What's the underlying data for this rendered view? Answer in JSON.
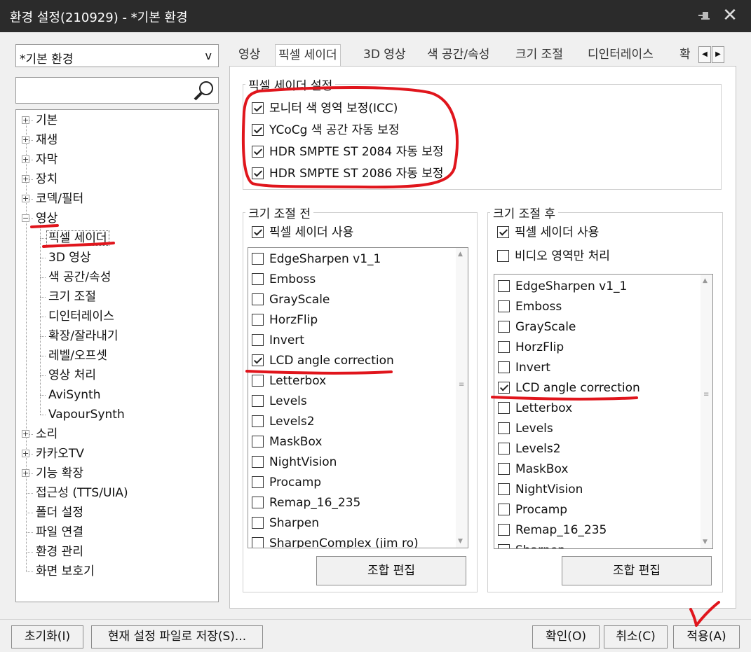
{
  "window": {
    "title": "환경 설정(210929) - *기본 환경",
    "pin_icon": "pin-icon",
    "close_icon": "close-icon"
  },
  "preset": {
    "value": "*기본 환경",
    "arrow": "v"
  },
  "search": {
    "value": "",
    "icon": "search-icon"
  },
  "tree": {
    "items": [
      {
        "label": "기본",
        "expander": "+"
      },
      {
        "label": "재생",
        "expander": "+"
      },
      {
        "label": "자막",
        "expander": "+"
      },
      {
        "label": "장치",
        "expander": "+"
      },
      {
        "label": "코덱/필터",
        "expander": "+"
      },
      {
        "label": "영상",
        "expander": "−"
      },
      {
        "label": "픽셀 세이더",
        "child": true,
        "selected": true
      },
      {
        "label": "3D 영상",
        "child": true
      },
      {
        "label": "색 공간/속성",
        "child": true
      },
      {
        "label": "크기 조절",
        "child": true
      },
      {
        "label": "디인터레이스",
        "child": true
      },
      {
        "label": "확장/잘라내기",
        "child": true
      },
      {
        "label": "레벨/오프셋",
        "child": true
      },
      {
        "label": "영상 처리",
        "child": true
      },
      {
        "label": "AviSynth",
        "child": true
      },
      {
        "label": "VapourSynth",
        "child": true
      },
      {
        "label": "소리",
        "expander": "+"
      },
      {
        "label": "카카오TV",
        "expander": "+"
      },
      {
        "label": "기능 확장",
        "expander": "+"
      },
      {
        "label": "접근성 (TTS/UIA)"
      },
      {
        "label": "폴더 설정"
      },
      {
        "label": "파일 연결"
      },
      {
        "label": "환경 관리"
      },
      {
        "label": "화면 보호기"
      }
    ]
  },
  "tabs": [
    "영상",
    "픽셀 세이더",
    "3D 영상",
    "색 공간/속성",
    "크기 조절",
    "디인터레이스",
    "확"
  ],
  "tab_nav": {
    "prev": "◀",
    "next": "▶"
  },
  "shader_settings": {
    "legend": "픽셀 세이더 설정",
    "options": [
      {
        "label": "모니터 색 영역 보정(ICC)",
        "checked": true
      },
      {
        "label": "YCoCg 색 공간 자동 보정",
        "checked": true
      },
      {
        "label": "HDR SMPTE ST 2084 자동 보정",
        "checked": true
      },
      {
        "label": "HDR SMPTE ST 2086 자동 보정",
        "checked": true
      }
    ]
  },
  "pre_resize": {
    "legend": "크기 조절 전",
    "use_shader": {
      "label": "픽셀 세이더 사용",
      "checked": true
    },
    "list": [
      "EdgeSharpen v1_1",
      "Emboss",
      "GrayScale",
      "HorzFlip",
      "Invert",
      "LCD angle correction",
      "Letterbox",
      "Levels",
      "Levels2",
      "MaskBox",
      "NightVision",
      "Procamp",
      "Remap_16_235",
      "Sharpen",
      "SharpenComplex (jim ro)"
    ],
    "checked_item": "LCD angle correction",
    "button": "조합 편집"
  },
  "post_resize": {
    "legend": "크기 조절 후",
    "use_shader": {
      "label": "픽셀 세이더 사용",
      "checked": true
    },
    "video_only": {
      "label": "비디오 영역만 처리",
      "checked": false
    },
    "list": [
      "EdgeSharpen v1_1",
      "Emboss",
      "GrayScale",
      "HorzFlip",
      "Invert",
      "LCD angle correction",
      "Letterbox",
      "Levels",
      "Levels2",
      "MaskBox",
      "NightVision",
      "Procamp",
      "Remap_16_235",
      "Sharpen"
    ],
    "checked_item": "LCD angle correction",
    "button": "조합 편집"
  },
  "footer": {
    "reset": "초기화(I)",
    "save_file": "현재 설정 파일로 저장(S)...",
    "ok": "확인(O)",
    "cancel": "취소(C)",
    "apply": "적용(A)"
  },
  "colors": {
    "annotation": "#e0151c",
    "titlebar": "#2b2b2b",
    "selection_bg": "#ffffff"
  }
}
